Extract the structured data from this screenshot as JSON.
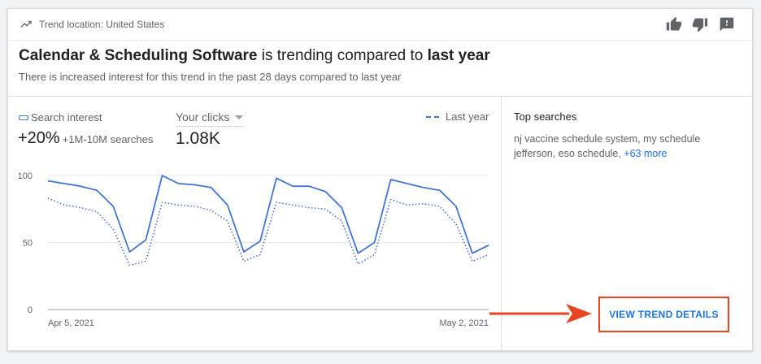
{
  "header": {
    "location_label": "Trend location: United States",
    "icons": [
      "trending-up-icon",
      "thumbs-up-icon",
      "thumbs-down-icon",
      "feedback-icon"
    ]
  },
  "trend": {
    "topic": "Calendar & Scheduling Software",
    "middle": " is trending compared to ",
    "period": "last year",
    "subtitle": "There is increased interest for this trend in the past 28 days compared to last year"
  },
  "stats": {
    "search_interest_label": "Search interest",
    "change": "+20%",
    "searches": "+1M-10M searches",
    "clicks_label": "Your clicks",
    "clicks_value": "1.08K",
    "last_year_label": "Last year"
  },
  "top_searches": {
    "title": "Top searches",
    "body": "nj vaccine schedule system, my schedule jefferson, eso schedule, ",
    "more": "+63 more"
  },
  "cta": {
    "label": "VIEW TREND DETAILS"
  },
  "colors": {
    "accent": "#1a73e8",
    "line": "#4274d6",
    "highlight": "#e8441f"
  },
  "chart_data": {
    "type": "line",
    "x_start_label": "Apr 5, 2021",
    "x_end_label": "May 2, 2021",
    "y_ticks": [
      "100",
      "50",
      "0"
    ],
    "ylim": [
      0,
      100
    ],
    "series": [
      {
        "name": "Search interest",
        "style": "solid",
        "values": [
          96,
          94,
          92,
          89,
          77,
          43,
          52,
          100,
          94,
          93,
          91,
          78,
          43,
          51,
          98,
          92,
          92,
          88,
          76,
          42,
          50,
          97,
          94,
          91,
          89,
          77,
          42,
          48
        ]
      },
      {
        "name": "Last year",
        "style": "dotted",
        "values": [
          83,
          78,
          76,
          73,
          60,
          33,
          36,
          80,
          78,
          77,
          74,
          66,
          36,
          41,
          80,
          78,
          76,
          75,
          66,
          34,
          41,
          82,
          78,
          79,
          77,
          64,
          36,
          41
        ]
      }
    ]
  }
}
